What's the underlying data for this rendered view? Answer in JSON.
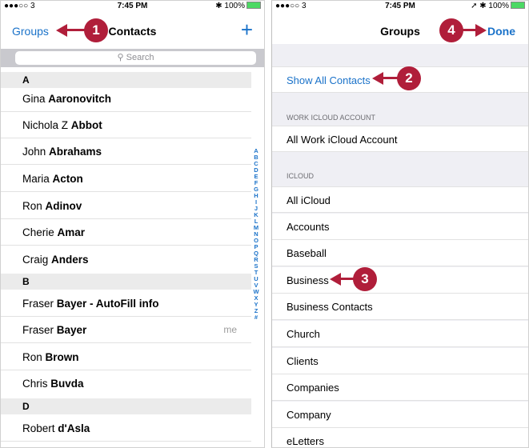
{
  "left": {
    "status": {
      "carrier": "●●●○○ 3",
      "time": "7:45 PM",
      "right": "✱ 100%"
    },
    "nav": {
      "left_link": "Groups",
      "title": "Contacts",
      "add": "+"
    },
    "search": {
      "placeholder": "Search"
    },
    "sections": [
      {
        "header": "A",
        "rows": [
          {
            "first": "Gina ",
            "last": "Aaronovitch"
          },
          {
            "first": "Nichola Z ",
            "last": "Abbot"
          },
          {
            "first": "John ",
            "last": "Abrahams"
          },
          {
            "first": "Maria ",
            "last": "Acton"
          },
          {
            "first": "Ron ",
            "last": "Adinov"
          },
          {
            "first": "Cherie ",
            "last": "Amar"
          },
          {
            "first": "Craig ",
            "last": "Anders"
          }
        ]
      },
      {
        "header": "B",
        "rows": [
          {
            "first": "Fraser ",
            "last": "Bayer - AutoFill info"
          },
          {
            "first": "Fraser ",
            "last": "Bayer",
            "tag": "me"
          },
          {
            "first": "Ron ",
            "last": "Brown"
          },
          {
            "first": "Chris ",
            "last": "Buvda"
          }
        ]
      },
      {
        "header": "D",
        "rows": [
          {
            "first": "Robert ",
            "last": "d'Asla"
          }
        ]
      }
    ],
    "index": [
      "A",
      "B",
      "C",
      "D",
      "E",
      "F",
      "G",
      "H",
      "I",
      "J",
      "K",
      "L",
      "M",
      "N",
      "O",
      "P",
      "Q",
      "R",
      "S",
      "T",
      "U",
      "V",
      "W",
      "X",
      "Y",
      "Z",
      "#"
    ]
  },
  "right": {
    "status": {
      "carrier": "●●●○○ 3",
      "time": "7:45 PM",
      "right": "➚ ✱ 100%"
    },
    "nav": {
      "title": "Groups",
      "done": "Done"
    },
    "show_all": "Show All Contacts",
    "work_header": "WORK ICLOUD ACCOUNT",
    "work_item": "All Work iCloud Account",
    "icloud_header": "ICLOUD",
    "icloud_items": [
      "All iCloud",
      "Accounts",
      "Baseball",
      "Business",
      "Business Contacts",
      "Church",
      "Clients",
      "Companies",
      "Company",
      "eLetters"
    ]
  },
  "callouts": [
    "1",
    "2",
    "3",
    "4"
  ],
  "colors": {
    "accent": "#1a72c9",
    "callout": "#b01e3a",
    "battery": "#4cd964"
  }
}
